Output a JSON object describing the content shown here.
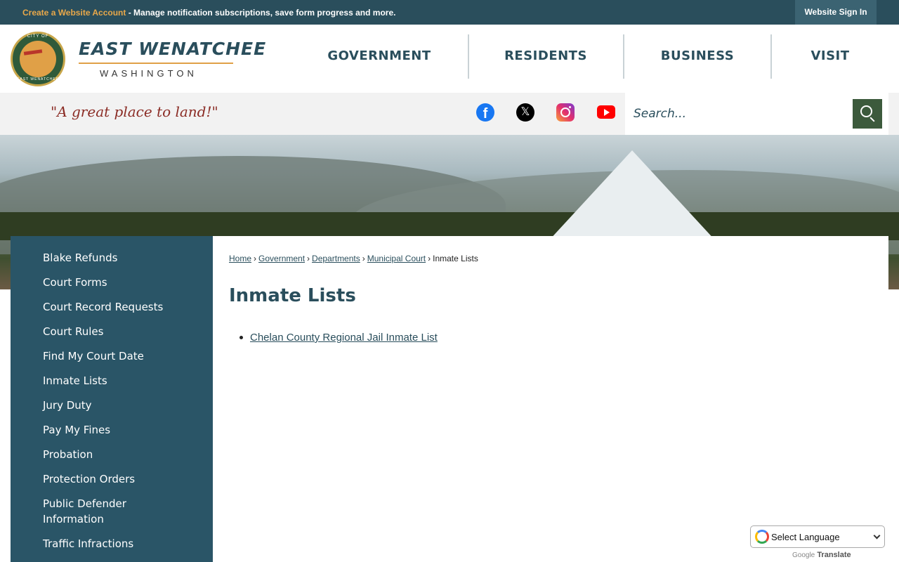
{
  "topbar": {
    "account_link": "Create a Website Account",
    "account_text": " - Manage notification subscriptions, save form progress and more.",
    "signin_label": "Website Sign In"
  },
  "logo": {
    "seal_top": "CITY OF",
    "seal_bottom": "EAST WENATCHEE",
    "name": "EAST WENATCHEE",
    "sub": "WASHINGTON"
  },
  "nav": {
    "items": [
      {
        "label": "GOVERNMENT"
      },
      {
        "label": "RESIDENTS"
      },
      {
        "label": "BUSINESS"
      },
      {
        "label": "VISIT"
      }
    ]
  },
  "tagline": "\"A great place to land!\"",
  "social": {
    "facebook_glyph": "f",
    "x_glyph": "𝕏"
  },
  "search": {
    "placeholder": "Search..."
  },
  "sidebar": {
    "items": [
      {
        "label": "Blake Refunds"
      },
      {
        "label": "Court Forms"
      },
      {
        "label": "Court Record Requests"
      },
      {
        "label": "Court Rules"
      },
      {
        "label": "Find My Court Date"
      },
      {
        "label": "Inmate Lists"
      },
      {
        "label": "Jury Duty"
      },
      {
        "label": "Pay My Fines"
      },
      {
        "label": "Probation"
      },
      {
        "label": "Protection Orders"
      },
      {
        "label": "Public Defender Information"
      },
      {
        "label": "Traffic Infractions"
      }
    ]
  },
  "breadcrumb": {
    "items": [
      "Home",
      "Government",
      "Departments",
      "Municipal Court"
    ],
    "separator": "›",
    "current": "Inmate Lists"
  },
  "main": {
    "title": "Inmate Lists",
    "links": [
      "Chelan County Regional Jail Inmate List"
    ]
  },
  "translate": {
    "select_label": "Select Language",
    "powered_google": "Google",
    "powered_translate": "Translate"
  },
  "colors": {
    "brand_dark": "#2a4e5c",
    "accent": "#e0a047",
    "tagline": "#8b2c25",
    "search_button": "#3c5a3c"
  }
}
